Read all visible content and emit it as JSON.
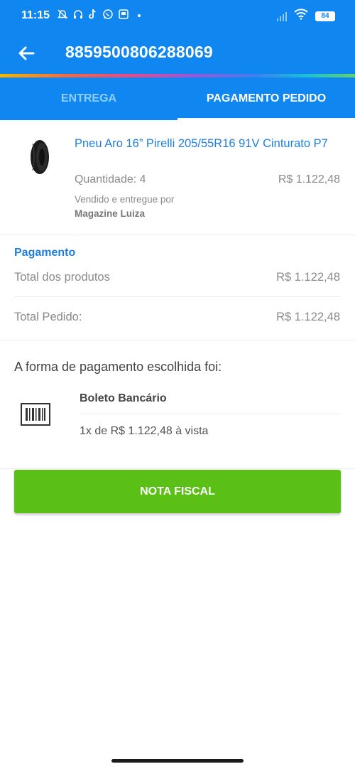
{
  "status_bar": {
    "time": "11:15",
    "battery": "84",
    "icons": [
      "bell-off-icon",
      "headset-icon",
      "tiktok-icon",
      "whatsapp-icon",
      "app-icon",
      "dot-icon",
      "signal-icon",
      "wifi-icon",
      "battery-icon"
    ]
  },
  "header": {
    "order_number": "8859500806288069",
    "back_icon": "arrow-left-icon",
    "background_color": "#0f86f0"
  },
  "tabs": [
    {
      "label": "ENTREGA",
      "active": false
    },
    {
      "label": "PAGAMENTO PEDIDO",
      "active": true
    }
  ],
  "product": {
    "name": "Pneu Aro 16” Pirelli 205/55R16 91V Cinturato P7",
    "quantity": "Quantidade: 4",
    "price": "R$ 1.122,48",
    "sold_by_label": "Vendido e entregue por",
    "seller": "Magazine Luiza"
  },
  "payment": {
    "heading": "Pagamento",
    "rows": [
      {
        "label": "Total dos produtos",
        "value": "R$ 1.122,48"
      },
      {
        "label": "Total Pedido:",
        "value": "R$ 1.122,48"
      }
    ]
  },
  "method": {
    "intro": "A forma de pagamento escolhida foi:",
    "name": "Boleto Bancário",
    "installment": "1x de R$ 1.122,48 à vista",
    "icon": "barcode-icon"
  },
  "actions": {
    "nota_fiscal": "NOTA FISCAL",
    "button_color": "#5bc015"
  },
  "colors": {
    "accent_blue": "#1f7fe0",
    "secondary_text": "#8a8a8a"
  }
}
